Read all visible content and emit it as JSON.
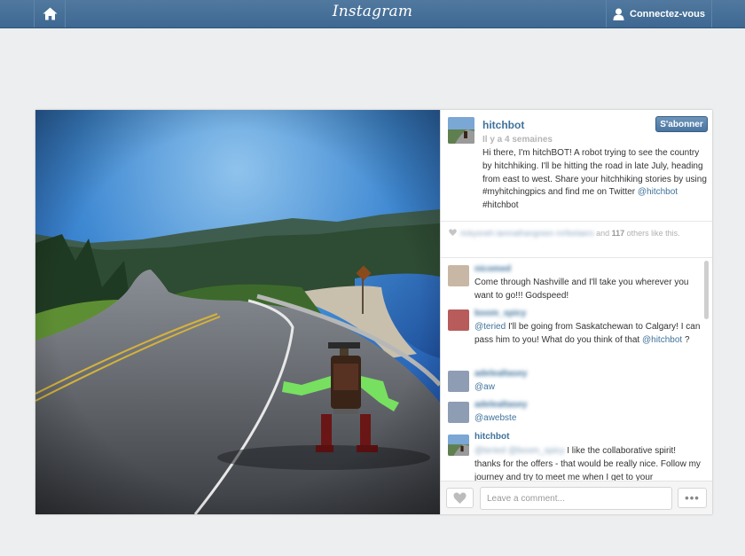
{
  "header": {
    "logo": "Instagram",
    "login_label": "Connectez-vous",
    "icons": {
      "home": "home-icon",
      "user": "user-icon"
    }
  },
  "post": {
    "owner": "hitchbot",
    "follow_label": "S'abonner",
    "time": "Il y a 4 semaines",
    "caption_text": "Hi there, I'm hitchBOT! A robot trying to see the country by hitchhiking. I'll be hitting the road in late July, heading from east to west. Share your hitchhiking stories by using #myhitchingpics and find me on Twitter ",
    "caption_mention": "@hitchbot",
    "caption_tag": " #hitchbot",
    "likes": {
      "names": "rickysneh iamnathangreen mrfeelaers",
      "and": " and ",
      "count": "117",
      "suffix": " others like this."
    }
  },
  "comments": [
    {
      "user": "nicomed",
      "text": "Come through Nashville and I'll take you wherever you want to go!!! Godspeed!"
    },
    {
      "user": "boom_spicy",
      "mention": "@teried",
      "text": " I'll be going from Saskatchewan to Calgary! I can pass him to you! What do you think of that ",
      "mention2": "@hitchbot",
      "text2": " ?"
    },
    {
      "user": "adelealtasey",
      "mention": "@aw"
    },
    {
      "user": "adelealtasey",
      "mention": "@awebste"
    },
    {
      "user": "hitchbot",
      "mention": "@teried @boom_spicy",
      "text": " I like the collaborative spirit! thanks for the offers - that would be really nice. Follow my journey and try to meet me when I get to your"
    }
  ],
  "footer": {
    "comment_placeholder": "Leave a comment...",
    "more_label": "•••"
  },
  "colors": {
    "topbar": "#46709a",
    "link": "#3f729b",
    "background": "#eceeef"
  }
}
